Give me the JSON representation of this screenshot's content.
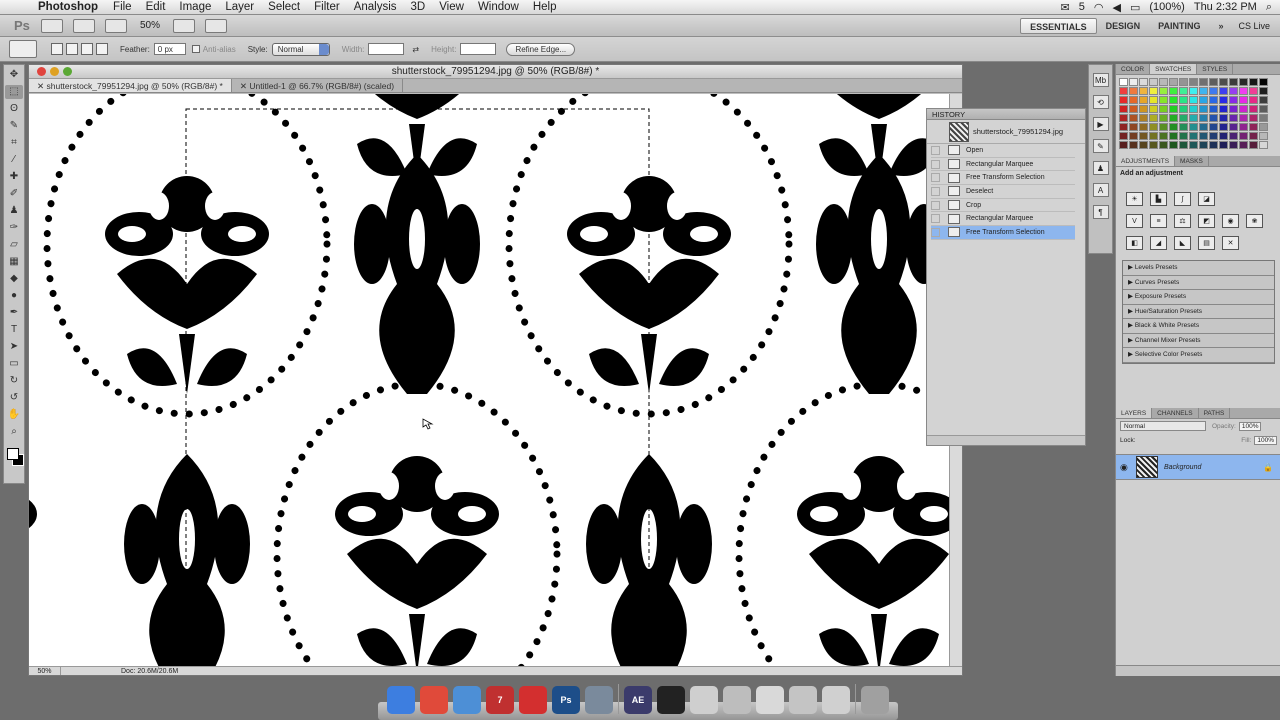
{
  "menubar": {
    "app_name": "Photoshop",
    "items": [
      "File",
      "Edit",
      "Image",
      "Layer",
      "Select",
      "Filter",
      "Analysis",
      "3D",
      "View",
      "Window",
      "Help"
    ],
    "battery": "(100%)",
    "clock": "Thu 2:32 PM",
    "badge": "5"
  },
  "appbar": {
    "logo": "Ps",
    "zoom": "50%",
    "workspaces": [
      "ESSENTIALS",
      "DESIGN",
      "PAINTING"
    ],
    "more": "»",
    "cslive": "CS Live"
  },
  "options": {
    "feather_label": "Feather:",
    "feather_value": "0 px",
    "antialias_label": "Anti-alias",
    "style_label": "Style:",
    "style_value": "Normal",
    "width_label": "Width:",
    "height_label": "Height:",
    "refine_button": "Refine Edge..."
  },
  "document": {
    "title": "shutterstock_79951294.jpg @ 50% (RGB/8#) *",
    "tabs": [
      {
        "label": "shutterstock_79951294.jpg @ 50% (RGB/8#) *",
        "active": true
      },
      {
        "label": "Untitled-1 @ 66.7% (RGB/8#) (scaled)",
        "active": false
      }
    ],
    "status_zoom": "50%",
    "status_doc": "Doc: 20.6M/20.6M"
  },
  "history": {
    "title": "HISTORY",
    "snapshot": "shutterstock_79951294.jpg",
    "steps": [
      "Open",
      "Rectangular Marquee",
      "Free Transform Selection",
      "Deselect",
      "Crop",
      "Rectangular Marquee",
      "Free Transform Selection"
    ],
    "active_index": 6
  },
  "swatches_panel": {
    "tabs": [
      "COLOR",
      "SWATCHES",
      "STYLES"
    ],
    "active": "SWATCHES"
  },
  "adjustments": {
    "tabs": [
      "ADJUSTMENTS",
      "MASKS"
    ],
    "title": "Add an adjustment",
    "presets": [
      "Levels Presets",
      "Curves Presets",
      "Exposure Presets",
      "Hue/Saturation Presets",
      "Black & White Presets",
      "Channel Mixer Presets",
      "Selective Color Presets"
    ]
  },
  "layers": {
    "tabs": [
      "LAYERS",
      "CHANNELS",
      "PATHS"
    ],
    "blend_mode": "Normal",
    "opacity_label": "Opacity:",
    "opacity": "100%",
    "lock_label": "Lock:",
    "fill_label": "Fill:",
    "fill": "100%",
    "layer_name": "Background"
  },
  "dock": {
    "apps": [
      {
        "name": "finder",
        "label": "",
        "color": "#3d7ee0"
      },
      {
        "name": "chrome",
        "label": "",
        "color": "#e04a3a"
      },
      {
        "name": "itunes",
        "label": "",
        "color": "#4d8fd6"
      },
      {
        "name": "ical",
        "label": "7",
        "color": "#c03030"
      },
      {
        "name": "lastfm",
        "label": "",
        "color": "#d32f2f"
      },
      {
        "name": "photoshop",
        "label": "Ps",
        "color": "#1d4e89"
      },
      {
        "name": "preview",
        "label": "",
        "color": "#7a8a9c"
      },
      {
        "name": "aftereffects",
        "label": "AE",
        "color": "#3b3b6b"
      },
      {
        "name": "music",
        "label": "",
        "color": "#222222"
      },
      {
        "name": "window1",
        "label": "",
        "color": "#cfcfcf"
      },
      {
        "name": "window2",
        "label": "",
        "color": "#bdbdbd"
      },
      {
        "name": "window3",
        "label": "",
        "color": "#d9d9d9"
      },
      {
        "name": "window4",
        "label": "",
        "color": "#c4c4c4"
      },
      {
        "name": "window5",
        "label": "",
        "color": "#d0d0d0"
      },
      {
        "name": "trash",
        "label": "",
        "color": "#a0a0a0"
      }
    ]
  },
  "colors": {
    "history_highlight": "#8db6ee",
    "canvas_bg": "#ffffff",
    "pattern": "#000000"
  }
}
